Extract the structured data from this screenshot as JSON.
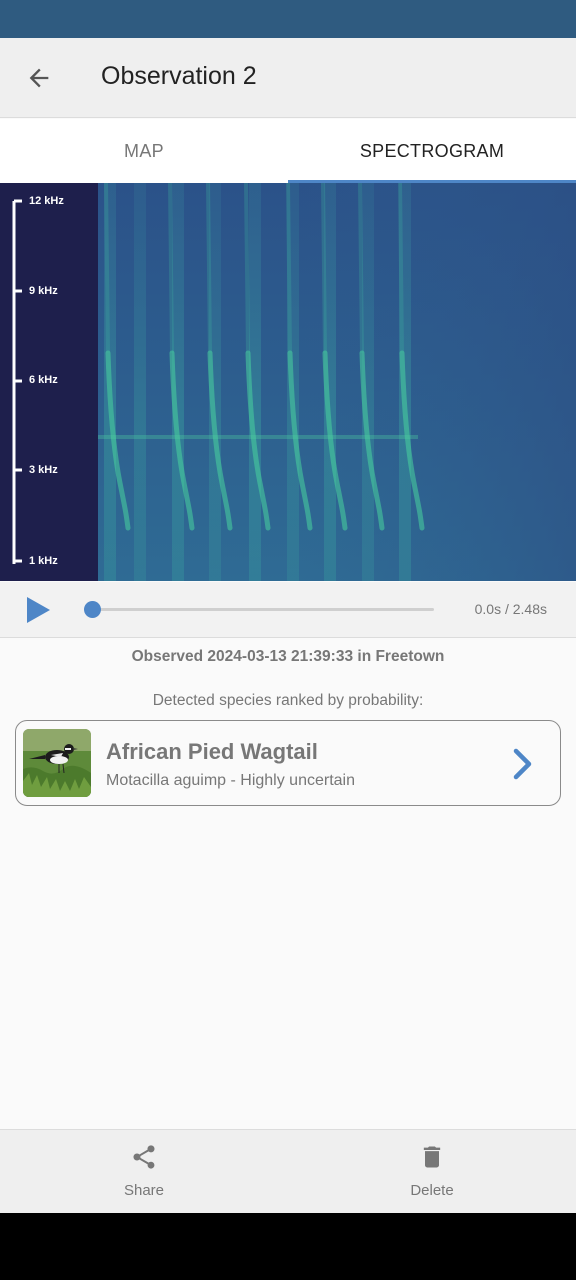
{
  "screen": {
    "title": "Observation 2",
    "back_icon": "arrow-back-icon"
  },
  "tabs": [
    {
      "label": "MAP",
      "active": false
    },
    {
      "label": "SPECTROGRAM",
      "active": true
    }
  ],
  "spectrogram": {
    "frequency_labels": [
      "12 kHz",
      "9 kHz",
      "6 kHz",
      "3 kHz",
      "1 kHz"
    ],
    "colors": {
      "axis_panel": "#1e1f4c",
      "background": "#2e5e90",
      "signal": "#3fd7a0"
    }
  },
  "player": {
    "play_icon": "play-icon",
    "progress": 0.0,
    "time": "0.0s / 2.48s"
  },
  "observation": {
    "observed_text": "Observed 2024-03-13 21:39:33 in Freetown",
    "detected_heading": "Detected species ranked by probability:"
  },
  "species": [
    {
      "common_name": "African Pied Wagtail",
      "scientific_line": "Motacilla aguimp - Highly uncertain",
      "thumbnail_icon": "bird-photo",
      "chevron_icon": "chevron-right-icon"
    }
  ],
  "bottom_nav": [
    {
      "label": "Share",
      "icon": "share-icon"
    },
    {
      "label": "Delete",
      "icon": "delete-icon"
    }
  ],
  "colors": {
    "accent": "#4e86c7",
    "status_bar": "#2f5b80",
    "muted_text": "#777777"
  }
}
